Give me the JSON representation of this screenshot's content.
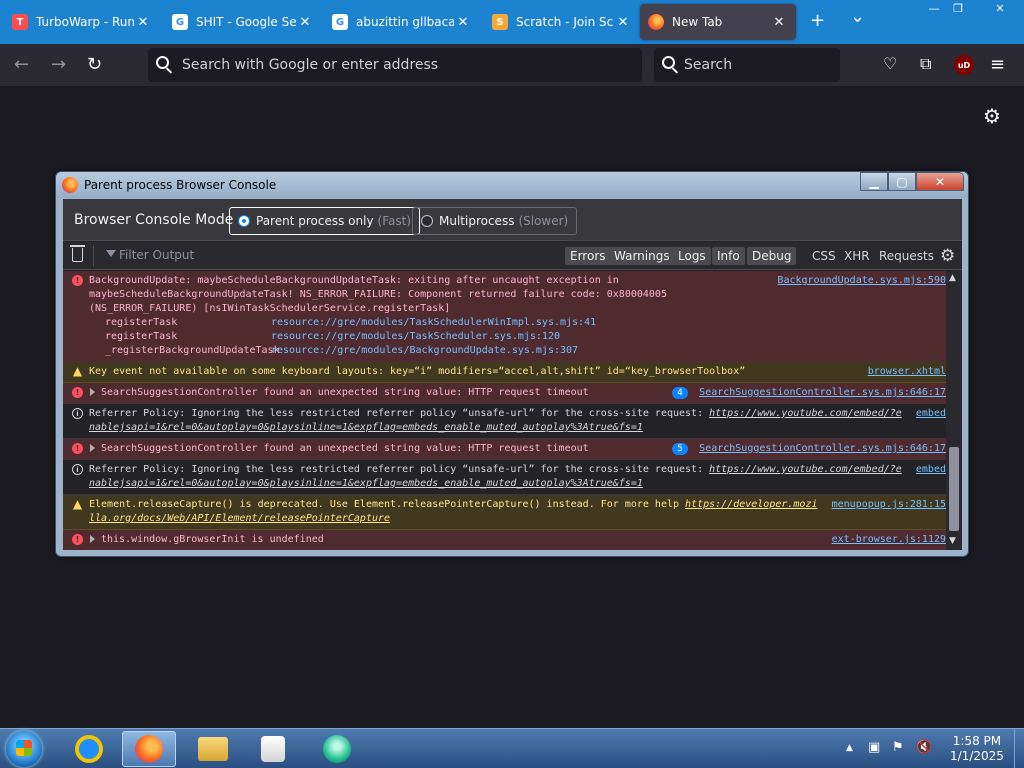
{
  "tabs": [
    {
      "title": "TurboWarp - Run S",
      "favicon": "turbowarp-icon",
      "color": "#ff4c4c"
    },
    {
      "title": "SHIT - Google Sear",
      "favicon": "google-icon",
      "color": "#ffffff"
    },
    {
      "title": "abuzittin gllbacak -",
      "favicon": "google-icon",
      "color": "#ffffff"
    },
    {
      "title": "Scratch - Join Scrat",
      "favicon": "scratch-icon",
      "color": "#f7a836"
    },
    {
      "title": "New Tab",
      "favicon": "firefox-icon",
      "color": "#ff7139"
    }
  ],
  "tab_close": "✕",
  "newtab_glyph": "+",
  "tablist_glyph": "⌄",
  "toolbar": {
    "url_placeholder": "Search with Google or enter address",
    "search_placeholder": "Search",
    "ublock_label": "uD"
  },
  "console": {
    "title": "Parent process Browser Console",
    "mode_label": "Browser Console Mode",
    "mode_parent": "Parent process only",
    "mode_parent_hint": "(Fast)",
    "mode_multi": "Multiprocess",
    "mode_multi_hint": "(Slower)",
    "filter_placeholder": "Filter Output",
    "filters": [
      "Errors",
      "Warnings",
      "Logs",
      "Info",
      "Debug"
    ],
    "extra_filters": [
      "CSS",
      "XHR",
      "Requests"
    ],
    "messages": [
      {
        "level": "error",
        "text": "BackgroundUpdate: maybeScheduleBackgroundUpdateTask: exiting after uncaught exception in\nmaybeScheduleBackgroundUpdateTask! NS_ERROR_FAILURE: Component returned failure code: 0x80004005\n(NS_ERROR_FAILURE) [nsIWinTaskSchedulerService.registerTask]",
        "source": "BackgroundUpdate.sys.mjs:590",
        "stack": [
          {
            "fn": "registerTask",
            "loc": "resource://gre/modules/TaskSchedulerWinImpl.sys.mjs:41"
          },
          {
            "fn": "registerTask",
            "loc": "resource://gre/modules/TaskScheduler.sys.mjs:120"
          },
          {
            "fn": "_registerBackgroundUpdateTask",
            "loc": "resource://gre/modules/BackgroundUpdate.sys.mjs:307"
          }
        ]
      },
      {
        "level": "warn",
        "text": "Key event not available on some keyboard layouts: key=“i” modifiers=“accel,alt,shift” id=“key_browserToolbox”",
        "source": "browser.xhtml"
      },
      {
        "level": "error",
        "text": "SearchSuggestionController found an unexpected string value: HTTP request timeout",
        "source": "SearchSuggestionController.sys.mjs:646:17",
        "count": "4"
      },
      {
        "level": "info",
        "text": "Referrer Policy: Ignoring the less restricted referrer policy “unsafe-url” for the cross-site request: ",
        "url1": "https://www.youtube.com/embed/?e",
        "url2": "nablejsapi=1&rel=0&autoplay=0&playsinline=1&expflag=embeds_enable_muted_autoplay%3Atrue&fs=1",
        "source": "embed"
      },
      {
        "level": "error",
        "text": "SearchSuggestionController found an unexpected string value: HTTP request timeout",
        "source": "SearchSuggestionController.sys.mjs:646:17",
        "count": "5"
      },
      {
        "level": "info",
        "text": "Referrer Policy: Ignoring the less restricted referrer policy “unsafe-url” for the cross-site request: ",
        "url1": "https://www.youtube.com/embed/?e",
        "url2": "nablejsapi=1&rel=0&autoplay=0&playsinline=1&expflag=embeds_enable_muted_autoplay%3Atrue&fs=1",
        "source": "embed"
      },
      {
        "level": "warn",
        "text": "Element.releaseCapture() is deprecated. Use Element.releasePointerCapture() instead. For more help ",
        "url1": "https://developer.mozi",
        "url2": "lla.org/docs/Web/API/Element/releasePointerCapture",
        "source": "menupopup.js:281:15"
      },
      {
        "level": "error",
        "text": "this.window.gBrowserInit is undefined",
        "source": "ext-browser.js:1129"
      }
    ]
  },
  "taskbar": {
    "time": "1:58 PM",
    "date": "1/1/2025",
    "apps": [
      "internet-explorer-icon",
      "firefox-icon",
      "file-explorer-icon",
      "media-player-icon",
      "turbowarp-icon"
    ]
  },
  "colors": {
    "tabstrip": "#1c83d1",
    "toolbar": "#2b2a33",
    "error_bg": "#4f2b30",
    "warn_bg": "#42381f",
    "link": "#75bfff"
  }
}
